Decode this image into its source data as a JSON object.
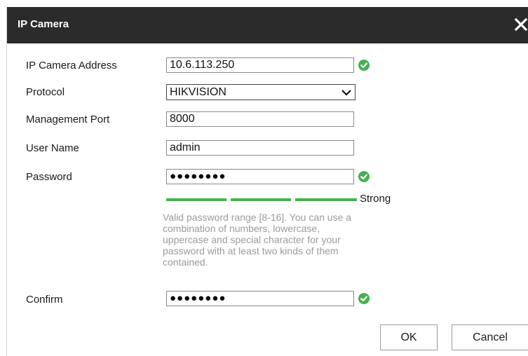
{
  "dialog": {
    "title": "IP Camera",
    "close_icon": "close-icon"
  },
  "form": {
    "address": {
      "label": "IP Camera Address",
      "value": "10.6.113.250",
      "valid": true
    },
    "protocol": {
      "label": "Protocol",
      "value": "HIKVISION"
    },
    "port": {
      "label": "Management Port",
      "value": "8000"
    },
    "username": {
      "label": "User Name",
      "value": "admin"
    },
    "password": {
      "label": "Password",
      "masked": "●●●●●●●●",
      "valid": true
    },
    "strength": {
      "label": "Strong",
      "level": 1.0,
      "color": "#43b14f"
    },
    "hint": "Valid password range [8-16]. You can use a combination of numbers, lowercase, uppercase and special character for your password with at least two kinds of them contained.",
    "confirm": {
      "label": "Confirm",
      "masked": "●●●●●●●●",
      "valid": true
    }
  },
  "buttons": {
    "ok": "OK",
    "cancel": "Cancel"
  },
  "colors": {
    "titlebar": "#2b2b2b",
    "valid": "#43b14f"
  }
}
